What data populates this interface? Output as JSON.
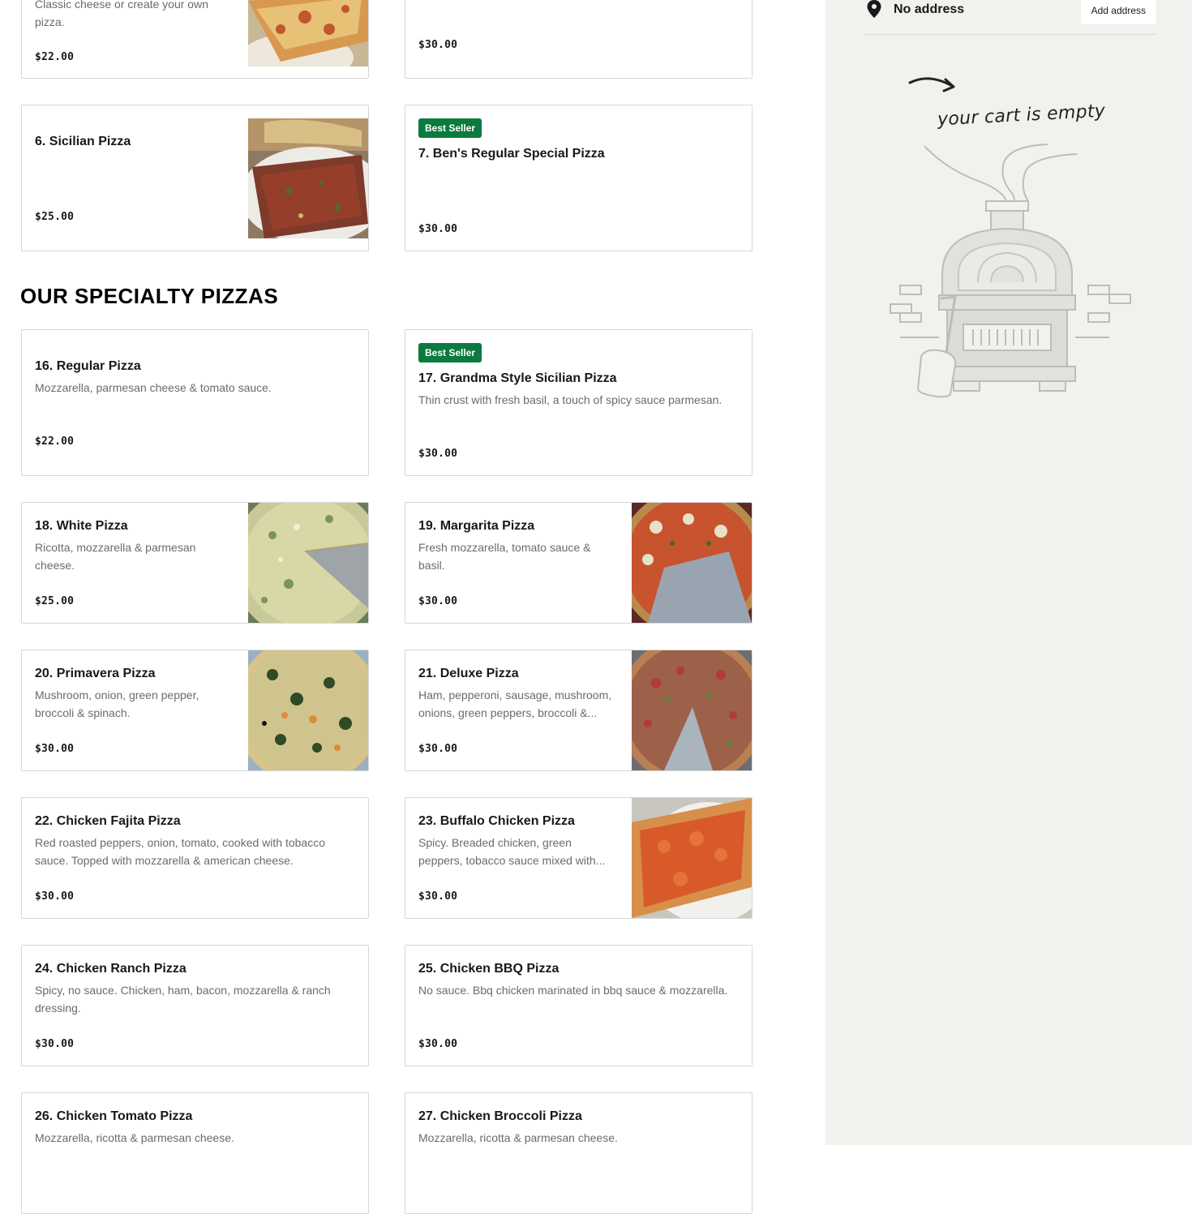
{
  "menu": {
    "section_title": "OUR SPECIALTY PIZZAS",
    "top_items": [
      {
        "desc": "Classic cheese or create your own pizza.",
        "price": "$22.00"
      },
      {
        "price": "$30.00"
      },
      {
        "name": "6. Sicilian Pizza",
        "price": "$25.00"
      },
      {
        "badge": "Best Seller",
        "name": "7. Ben's Regular Special Pizza",
        "price": "$30.00"
      }
    ],
    "specialty_items": [
      {
        "name": "16. Regular Pizza",
        "desc": "Mozzarella, parmesan cheese & tomato sauce.",
        "price": "$22.00"
      },
      {
        "badge": "Best Seller",
        "name": "17. Grandma Style Sicilian Pizza",
        "desc": "Thin crust with fresh basil, a touch of spicy sauce parmesan.",
        "price": "$30.00"
      },
      {
        "name": "18. White Pizza",
        "desc": "Ricotta, mozzarella & parmesan cheese.",
        "price": "$25.00"
      },
      {
        "name": "19. Margarita Pizza",
        "desc": "Fresh mozzarella, tomato sauce & basil.",
        "price": "$30.00"
      },
      {
        "name": "20. Primavera Pizza",
        "desc": "Mushroom, onion, green pepper, broccoli & spinach.",
        "price": "$30.00"
      },
      {
        "name": "21. Deluxe Pizza",
        "desc": "Ham, pepperoni, sausage, mushroom, onions, green peppers, broccoli &...",
        "price": "$30.00"
      },
      {
        "name": "22. Chicken Fajita Pizza",
        "desc": "Red roasted peppers, onion, tomato, cooked with tobacco sauce. Topped with mozzarella & american cheese.",
        "price": "$30.00"
      },
      {
        "name": "23. Buffalo Chicken Pizza",
        "desc": "Spicy. Breaded chicken, green peppers, tobacco sauce mixed with...",
        "price": "$30.00"
      },
      {
        "name": "24. Chicken Ranch Pizza",
        "desc": "Spicy, no sauce. Chicken, ham, bacon, mozzarella & ranch dressing.",
        "price": "$30.00"
      },
      {
        "name": "25. Chicken BBQ Pizza",
        "desc": "No sauce. Bbq chicken marinated in bbq sauce & mozzarella.",
        "price": "$30.00"
      },
      {
        "name": "26. Chicken Tomato Pizza",
        "desc": "Mozzarella, ricotta & parmesan cheese."
      },
      {
        "name": "27. Chicken Broccoli Pizza",
        "desc": "Mozzarella, ricotta & parmesan cheese."
      }
    ]
  },
  "cart": {
    "address_text": "No address",
    "add_address_label": "Add address",
    "empty_text": "your cart is empty"
  },
  "colors": {
    "badge": "#0b7a3e",
    "sidebar_bg": "#f2f1ee"
  }
}
